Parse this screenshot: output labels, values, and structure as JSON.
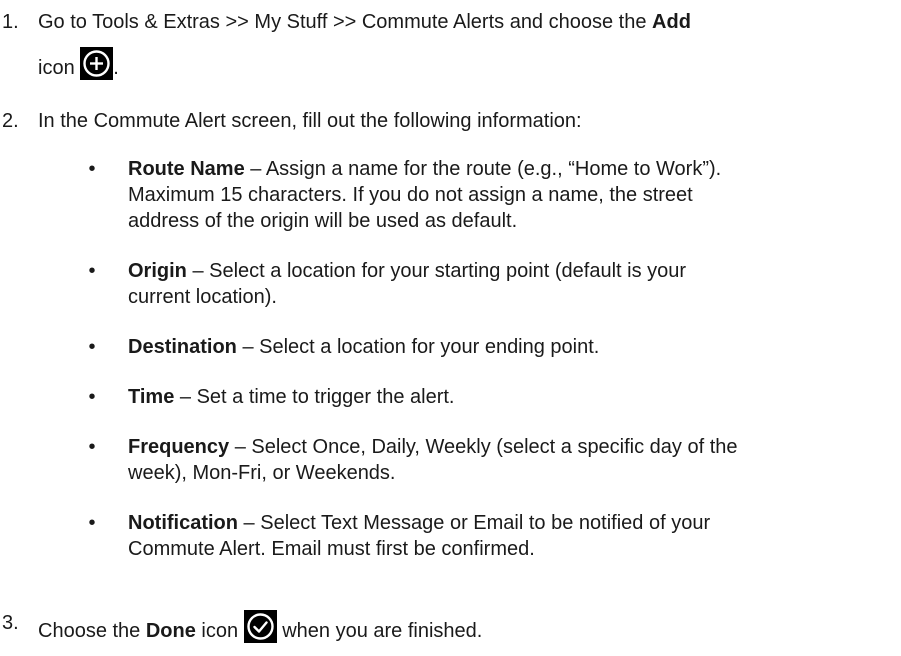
{
  "steps": [
    {
      "number": "1.",
      "text_before": "Go to Tools & Extras >> My Stuff >> Commute Alerts and choose the ",
      "bold": "Add",
      "text_line2_before_icon": "icon ",
      "icon": "add-circle-icon",
      "text_after_icon": "."
    },
    {
      "number": "2.",
      "text": "In the Commute Alert screen, fill out the following information:"
    },
    {
      "number": "3.",
      "text_before": "Choose the ",
      "bold": "Done",
      "text_mid": " icon ",
      "icon": "checkmark-circle-icon",
      "text_after_icon": " when you are finished."
    }
  ],
  "bullets": [
    {
      "term": "Route Name",
      "lines": [
        " – Assign a name for the route (e.g., “Home to Work”).",
        "Maximum 15 characters. If you do not assign a name, the street",
        "address of the origin will be used as default."
      ]
    },
    {
      "term": "Origin",
      "lines": [
        " – Select a location for your starting point (default is your",
        "current location)."
      ]
    },
    {
      "term": "Destination",
      "lines": [
        " – Select a location for your ending point."
      ]
    },
    {
      "term": "Time",
      "lines": [
        " – Set a time to trigger the alert."
      ]
    },
    {
      "term": "Frequency",
      "lines": [
        " – Select Once, Daily, Weekly (select a specific day of the",
        "week), Mon-Fri, or Weekends."
      ]
    },
    {
      "term": "Notification",
      "lines": [
        " – Select Text Message or Email to be notified of your",
        "Commute Alert. Email must first be confirmed."
      ]
    }
  ],
  "bullet_symbol": "•",
  "icon_colors": {
    "background": "#000000",
    "foreground": "#ffffff"
  }
}
